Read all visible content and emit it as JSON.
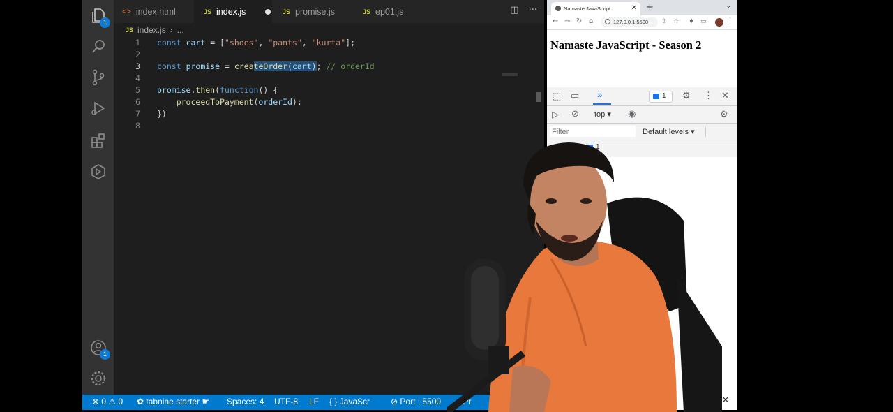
{
  "editor": {
    "tabs": [
      {
        "label": "index.html",
        "type": "html",
        "active": false
      },
      {
        "label": "index.js",
        "type": "js",
        "active": true,
        "dirty": true
      },
      {
        "label": "promise.js",
        "type": "js",
        "active": false
      },
      {
        "label": "ep01.js",
        "type": "js",
        "active": false
      }
    ],
    "breadcrumb": {
      "file": "index.js",
      "more": "..."
    },
    "activity_badges": {
      "explorer": "1",
      "accounts": "1"
    },
    "lines": [
      {
        "n": "1",
        "text": "const cart = [\"shoes\", \"pants\", \"kurta\"];"
      },
      {
        "n": "2",
        "text": ""
      },
      {
        "n": "3",
        "text": "const promise = createOrder(cart); // orderId"
      },
      {
        "n": "4",
        "text": ""
      },
      {
        "n": "5",
        "text": "promise.then(function() {"
      },
      {
        "n": "6",
        "text": "    proceedToPayment(orderId);"
      },
      {
        "n": "7",
        "text": "})"
      },
      {
        "n": "8",
        "text": ""
      }
    ],
    "tokens": {
      "const": "const",
      "cart": "cart",
      "eq": "=",
      "lbr": "[",
      "s_shoes": "\"shoes\"",
      "s_pants": "\"pants\"",
      "s_kurta": "\"kurta\"",
      "comma": ",",
      "rbr_semi": "];",
      "promise": "promise",
      "fn_crea": "crea",
      "fn_teOrder": "teOrder",
      "lparen": "(",
      "rparen": ")",
      "semi": ";",
      "comment": "// orderId",
      "dot": ".",
      "then": "then",
      "function": "function",
      "paren_pair": "()",
      "lbrace": "{",
      "proceed": "proceedToPayment",
      "orderId": "orderId",
      "close_block": "})"
    }
  },
  "statusbar": {
    "problems": "0",
    "warnings": "0",
    "tabnine": "tabnine starter",
    "spaces": "Spaces: 4",
    "encoding": "UTF-8",
    "eol": "LF",
    "language": "JavaScr",
    "port": "Port : 5500",
    "prettier": "Pr"
  },
  "browser": {
    "tab_title": "Namaste JavaScript",
    "url": "127.0.0.1:5500",
    "page_heading": "Namaste JavaScript - Season 2",
    "devtools": {
      "issues_count": "1",
      "context": "top",
      "filter_placeholder": "Filter",
      "levels": "Default levels",
      "message_count": "1"
    }
  },
  "colors": {
    "statusbar": "#007acc",
    "editor_bg": "#1e1e1e",
    "selection": "#264f78",
    "keyword": "#569cd6",
    "variable": "#9cdcfe",
    "function": "#dcdcaa",
    "string": "#ce9178",
    "comment": "#6a9955"
  }
}
